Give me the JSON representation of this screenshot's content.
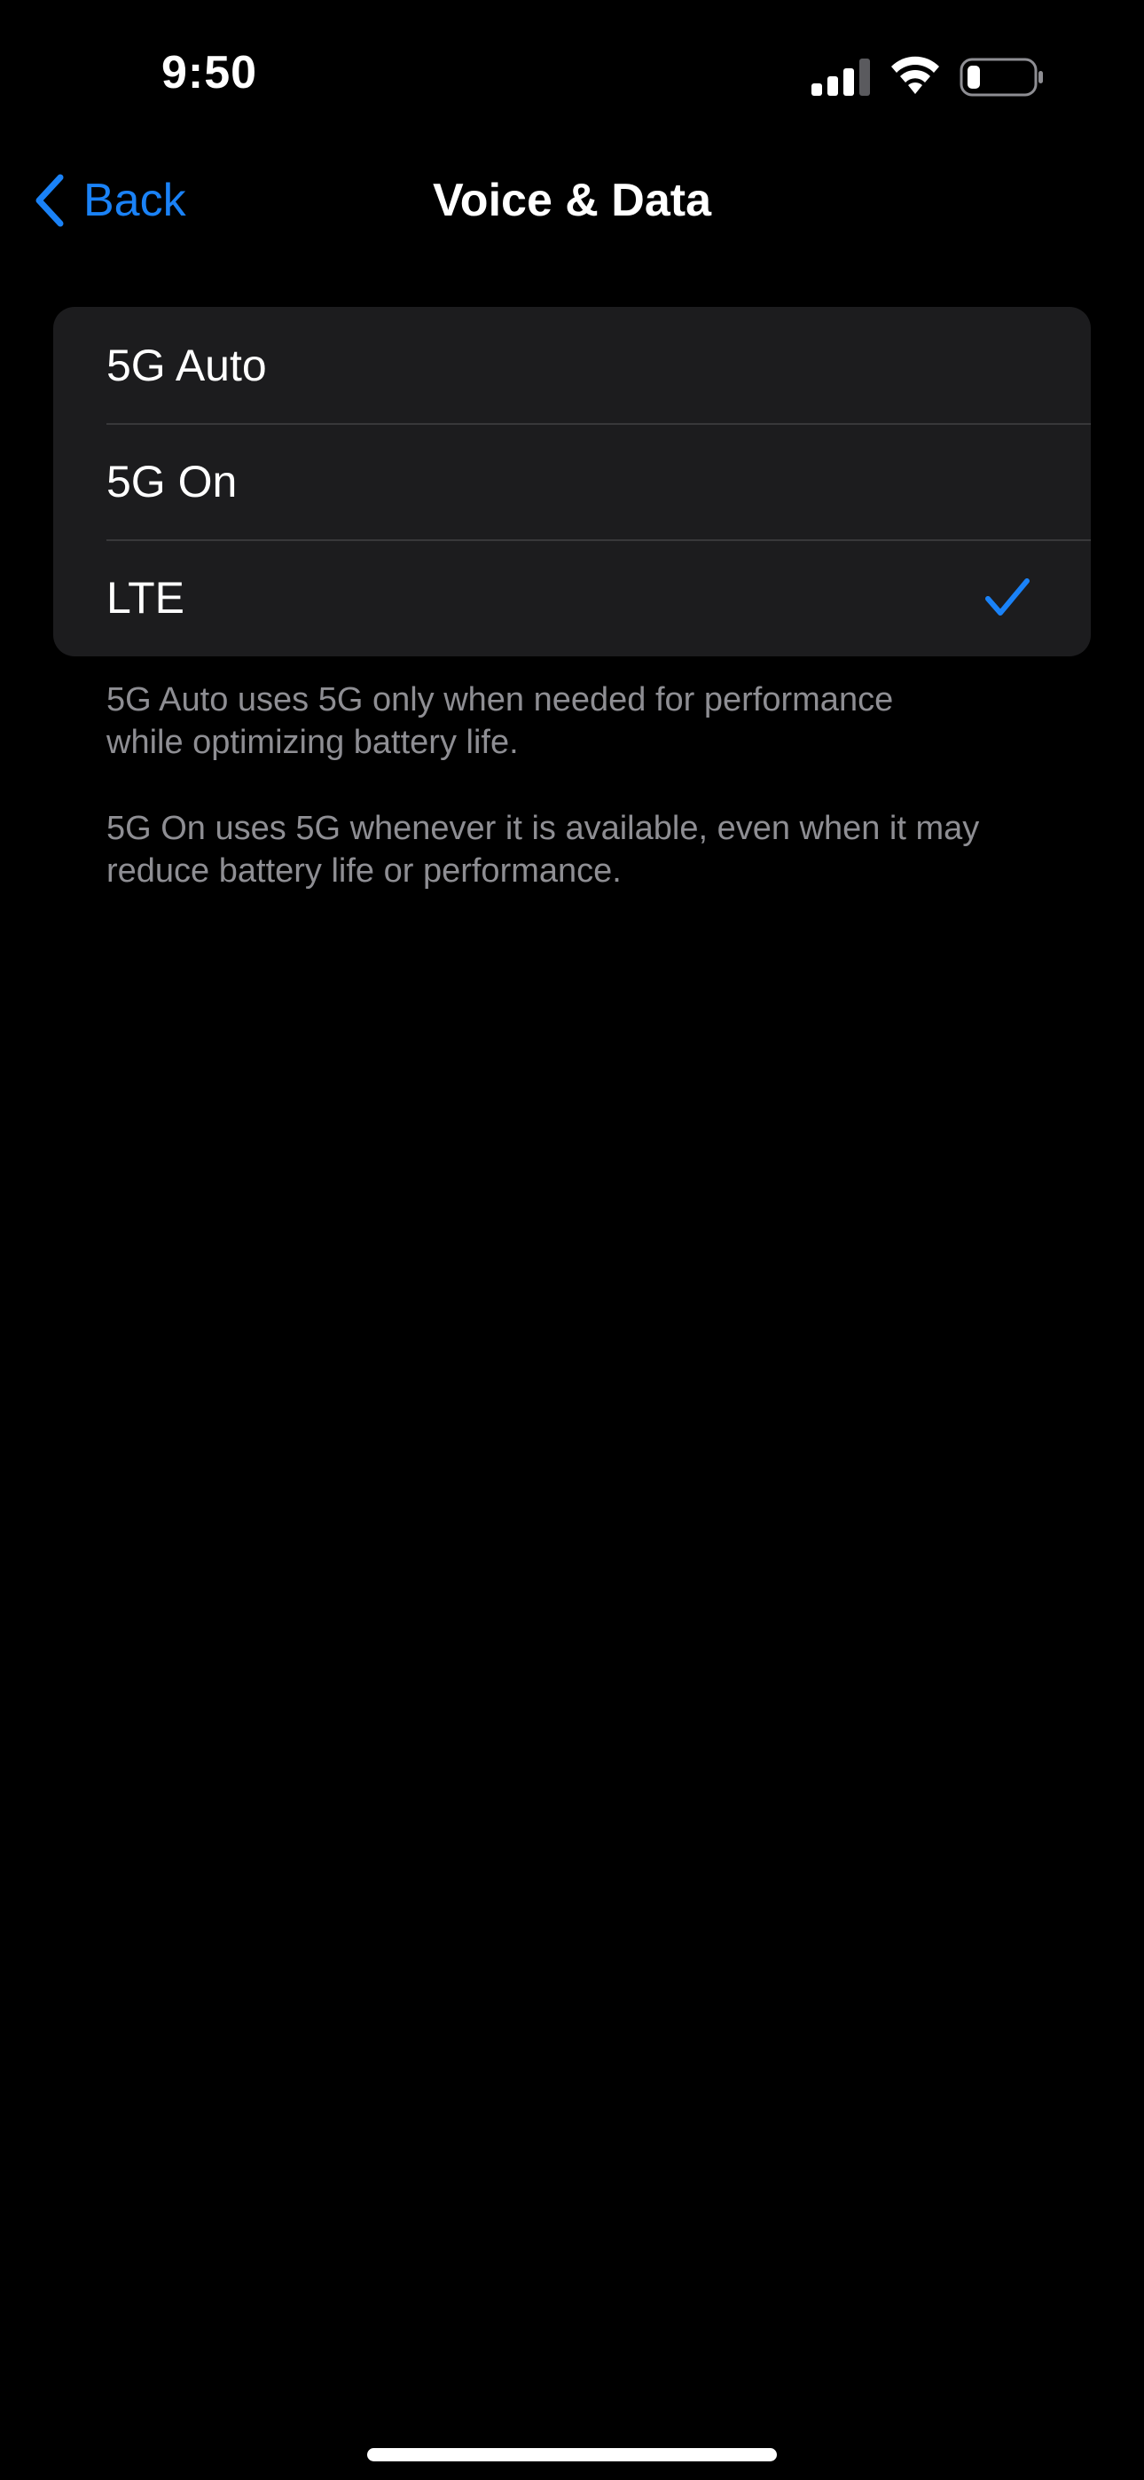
{
  "status_bar": {
    "time": "9:50",
    "signal_icon": "cellular-signal-icon",
    "wifi_icon": "wifi-icon",
    "battery_icon": "battery-low-icon"
  },
  "nav": {
    "back_label": "Back",
    "back_icon": "chevron-left-icon",
    "title": "Voice & Data"
  },
  "options": [
    {
      "label": "5G Auto",
      "selected": false
    },
    {
      "label": "5G On",
      "selected": false
    },
    {
      "label": "LTE",
      "selected": true
    }
  ],
  "footer": {
    "auto_description_lines": [
      "5G Auto uses 5G only when needed for performance",
      "while optimizing battery life."
    ],
    "on_description_lines": [
      "5G On uses 5G whenever it is available, even when it may",
      "reduce battery life or performance."
    ]
  },
  "colors": {
    "accent": "#1a82f7",
    "background": "#000000",
    "group_background": "#1c1c1e",
    "secondary_text": "#8e8e93"
  }
}
